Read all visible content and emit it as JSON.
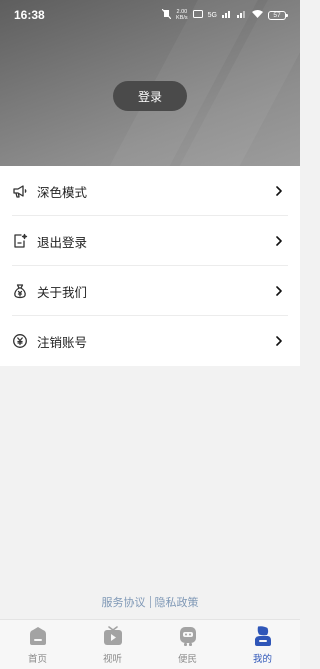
{
  "status_bar": {
    "time": "16:38",
    "net_speed_value": "2.00",
    "net_speed_unit": "KB/s",
    "signal_label": "5G",
    "battery": "57"
  },
  "header": {
    "login_label": "登录"
  },
  "menu": {
    "items": [
      {
        "label": "深色模式",
        "icon": "megaphone-icon"
      },
      {
        "label": "退出登录",
        "icon": "logout-icon"
      },
      {
        "label": "关于我们",
        "icon": "money-bag-icon"
      },
      {
        "label": "注销账号",
        "icon": "yen-circle-icon"
      }
    ]
  },
  "footer_links": {
    "service_agreement": "服务协议",
    "privacy_policy": "隐私政策"
  },
  "tabbar": {
    "active_color": "#2f56b8",
    "items": [
      {
        "label": "首页",
        "icon": "home-icon"
      },
      {
        "label": "视听",
        "icon": "tv-icon"
      },
      {
        "label": "便民",
        "icon": "robot-icon"
      },
      {
        "label": "我的",
        "icon": "profile-icon",
        "active": true
      }
    ]
  }
}
